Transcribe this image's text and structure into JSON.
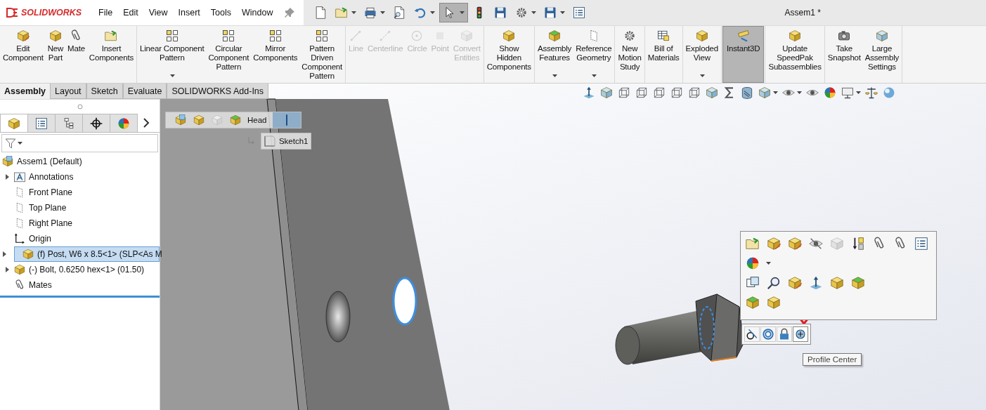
{
  "app": {
    "logo": "SOLIDWORKS",
    "menus": [
      "File",
      "Edit",
      "View",
      "Insert",
      "Tools",
      "Window"
    ],
    "title": "Assem1 *"
  },
  "quick_access": [
    {
      "pressed": false
    },
    {
      "pressed": false
    },
    {
      "pressed": false
    },
    {
      "pressed": false
    },
    {
      "pressed": false
    },
    {
      "pressed": true
    },
    {
      "pressed": false
    },
    {
      "pressed": false
    },
    {
      "pressed": false
    },
    {
      "pressed": false
    },
    {
      "pressed": false
    }
  ],
  "ribbon": {
    "groups": [
      [
        {
          "label": "Edit\nComponent",
          "disabled": false,
          "dropdown": false,
          "selected": false
        },
        {
          "label": "New\nPart",
          "disabled": false,
          "dropdown": false,
          "selected": false
        },
        {
          "label": "Mate",
          "disabled": false,
          "dropdown": false,
          "selected": false
        },
        {
          "label": "Insert\nComponents",
          "disabled": false,
          "dropdown": false,
          "selected": false
        }
      ],
      [
        {
          "label": "Linear Component\nPattern",
          "disabled": false,
          "dropdown": true,
          "selected": false
        },
        {
          "label": "Circular\nComponent\nPattern",
          "disabled": false,
          "dropdown": false,
          "selected": false
        },
        {
          "label": "Mirror\nComponents",
          "disabled": false,
          "dropdown": false,
          "selected": false
        },
        {
          "label": "Pattern\nDriven\nComponent\nPattern",
          "disabled": false,
          "dropdown": false,
          "selected": false
        }
      ],
      [
        {
          "label": "Line",
          "disabled": true,
          "dropdown": false,
          "selected": false
        },
        {
          "label": "Centerline",
          "disabled": true,
          "dropdown": false,
          "selected": false
        },
        {
          "label": "Circle",
          "disabled": true,
          "dropdown": false,
          "selected": false
        },
        {
          "label": "Point",
          "disabled": true,
          "dropdown": false,
          "selected": false
        },
        {
          "label": "Convert\nEntities",
          "disabled": true,
          "dropdown": false,
          "selected": false
        }
      ],
      [
        {
          "label": "Show\nHidden\nComponents",
          "disabled": false,
          "dropdown": false,
          "selected": false
        }
      ],
      [
        {
          "label": "Assembly\nFeatures",
          "disabled": false,
          "dropdown": true,
          "selected": false
        },
        {
          "label": "Reference\nGeometry",
          "disabled": false,
          "dropdown": true,
          "selected": false
        }
      ],
      [
        {
          "label": "New\nMotion\nStudy",
          "disabled": false,
          "dropdown": false,
          "selected": false
        }
      ],
      [
        {
          "label": "Bill of\nMaterials",
          "disabled": false,
          "dropdown": false,
          "selected": false
        }
      ],
      [
        {
          "label": "Exploded\nView",
          "disabled": false,
          "dropdown": true,
          "selected": false
        }
      ],
      [
        {
          "label": "Instant3D",
          "disabled": false,
          "dropdown": false,
          "selected": true
        }
      ],
      [
        {
          "label": "Update\nSpeedPak\nSubassemblies",
          "disabled": false,
          "dropdown": false,
          "selected": false
        }
      ],
      [
        {
          "label": "Take\nSnapshot",
          "disabled": false,
          "dropdown": false,
          "selected": false
        },
        {
          "label": "Large\nAssembly\nSettings",
          "disabled": false,
          "dropdown": false,
          "selected": false
        }
      ]
    ]
  },
  "command_tabs": [
    {
      "label": "Assembly",
      "selected": true
    },
    {
      "label": "Layout",
      "selected": false
    },
    {
      "label": "Sketch",
      "selected": false
    },
    {
      "label": "Evaluate",
      "selected": false
    },
    {
      "label": "SOLIDWORKS Add-Ins",
      "selected": false
    }
  ],
  "panel_tabs": [
    {
      "selected": true
    },
    {
      "selected": false
    },
    {
      "selected": false
    },
    {
      "selected": false
    },
    {
      "selected": false
    }
  ],
  "feature_tree": {
    "label": "Assem1 (Default)",
    "kind": "assembly",
    "children": [
      {
        "label": "Annotations",
        "kind": "annotations",
        "expandable": true,
        "expanded": false,
        "selected": false
      },
      {
        "label": "Front Plane",
        "kind": "plane",
        "expandable": false,
        "selected": false
      },
      {
        "label": "Top Plane",
        "kind": "plane",
        "expandable": false,
        "selected": false
      },
      {
        "label": "Right Plane",
        "kind": "plane",
        "expandable": false,
        "selected": false
      },
      {
        "label": "Origin",
        "kind": "origin",
        "expandable": false,
        "selected": false
      },
      {
        "label": "(f) Post, W6 x 8.5<1> (SLP<As M",
        "kind": "component",
        "expandable": true,
        "expanded": false,
        "selected": true
      },
      {
        "label": "(-) Bolt, 0.6250 hex<1> (01.50)",
        "kind": "component",
        "expandable": true,
        "expanded": false,
        "selected": false
      },
      {
        "label": "Mates",
        "kind": "mates",
        "expandable": false,
        "selected": false
      }
    ]
  },
  "breadcrumb": {
    "label": "Head",
    "sketch": "Sketch1"
  },
  "profile_tools": [
    {
      "highlighted": false
    },
    {
      "highlighted": false
    },
    {
      "highlighted": false
    },
    {
      "highlighted": true
    }
  ],
  "tooltip": "Profile Center"
}
